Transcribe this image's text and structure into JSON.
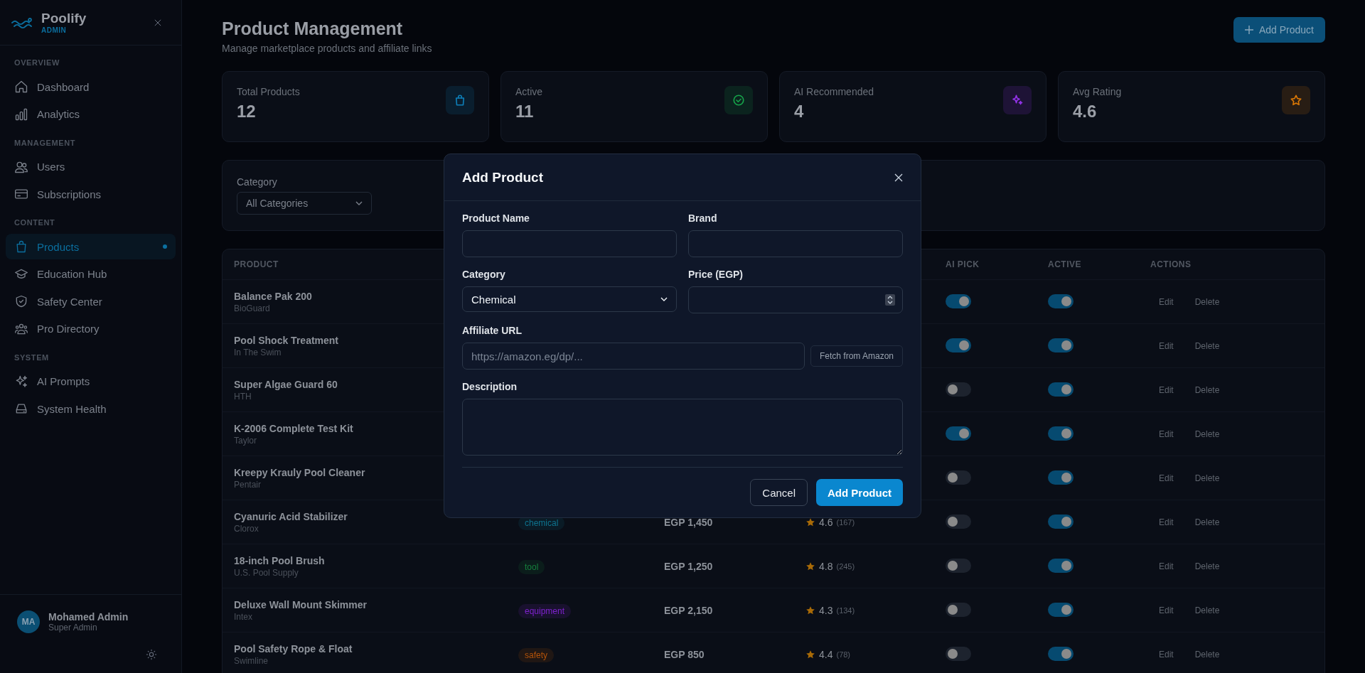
{
  "sidebar": {
    "brand": "Poolify",
    "badge": "ADMIN",
    "sections": [
      {
        "title": "OVERVIEW",
        "items": [
          {
            "label": "Dashboard",
            "selected": false
          },
          {
            "label": "Analytics",
            "selected": false
          }
        ]
      },
      {
        "title": "MANAGEMENT",
        "items": [
          {
            "label": "Users",
            "selected": false
          },
          {
            "label": "Subscriptions",
            "selected": false
          }
        ]
      },
      {
        "title": "CONTENT",
        "items": [
          {
            "label": "Products",
            "selected": true
          },
          {
            "label": "Education Hub",
            "selected": false
          },
          {
            "label": "Safety Center",
            "selected": false
          },
          {
            "label": "Pro Directory",
            "selected": false
          }
        ]
      },
      {
        "title": "SYSTEM",
        "items": [
          {
            "label": "AI Prompts",
            "selected": false
          },
          {
            "label": "System Health",
            "selected": false
          }
        ]
      }
    ],
    "user": {
      "initials": "MA",
      "name": "Mohamed Admin",
      "role": "Super Admin"
    }
  },
  "header": {
    "title": "Product Management",
    "subtitle": "Manage marketplace products and affiliate links",
    "action": "Add Product"
  },
  "stats": [
    {
      "label": "Total Products",
      "value": "12",
      "color": "#0e7fb8"
    },
    {
      "label": "Active",
      "value": "11",
      "color": "#16a34a"
    },
    {
      "label": "AI Recommended",
      "value": "4",
      "color": "#9333ea"
    },
    {
      "label": "Avg Rating",
      "value": "4.6",
      "color": "#d97706"
    }
  ],
  "filter": {
    "label": "Category",
    "value": "All Categories"
  },
  "table": {
    "columns": {
      "product": "PRODUCT",
      "ai_pick": "AI PICK",
      "active": "ACTIVE",
      "actions": "ACTIONS"
    },
    "rows": [
      {
        "name": "Balance Pak 200",
        "brand": "BioGuard",
        "ai_pick": true,
        "active": true,
        "actions": [
          "Edit",
          "Delete"
        ]
      },
      {
        "name": "Pool Shock Treatment",
        "brand": "In The Swim",
        "ai_pick": true,
        "active": true,
        "actions": [
          "Edit",
          "Delete"
        ]
      },
      {
        "name": "Super Algae Guard 60",
        "brand": "HTH",
        "ai_pick": false,
        "active": true,
        "actions": [
          "Edit",
          "Delete"
        ]
      },
      {
        "name": "K-2006 Complete Test Kit",
        "brand": "Taylor",
        "ai_pick": true,
        "active": true,
        "actions": [
          "Edit",
          "Delete"
        ]
      },
      {
        "name": "Kreepy Krauly Pool Cleaner",
        "brand": "Pentair",
        "ai_pick": false,
        "active": true,
        "actions": [
          "Edit",
          "Delete"
        ]
      },
      {
        "name": "Cyanuric Acid Stabilizer",
        "brand": "Clorox",
        "tag": {
          "label": "chemical",
          "color": "#0e7490"
        },
        "price": "EGP 1,450",
        "rating": "4.6",
        "reviews": "(167)",
        "ai_pick": false,
        "active": true,
        "actions": [
          "Edit",
          "Delete"
        ]
      },
      {
        "name": "18-inch Pool Brush",
        "brand": "U.S. Pool Supply",
        "tag": {
          "label": "tool",
          "color": "#15803d"
        },
        "price": "EGP 1,250",
        "rating": "4.8",
        "reviews": "(245)",
        "ai_pick": false,
        "active": true,
        "actions": [
          "Edit",
          "Delete"
        ]
      },
      {
        "name": "Deluxe Wall Mount Skimmer",
        "brand": "Intex",
        "tag": {
          "label": "equipment",
          "color": "#7e22ce"
        },
        "price": "EGP 2,150",
        "rating": "4.3",
        "reviews": "(134)",
        "ai_pick": false,
        "active": true,
        "actions": [
          "Edit",
          "Delete"
        ]
      },
      {
        "name": "Pool Safety Rope & Float",
        "brand": "Swimline",
        "tag": {
          "label": "safety",
          "color": "#b45309"
        },
        "price": "EGP 850",
        "rating": "4.4",
        "reviews": "(78)",
        "ai_pick": false,
        "active": true,
        "actions": [
          "Edit",
          "Delete"
        ]
      }
    ]
  },
  "modal": {
    "title": "Add Product",
    "fields": [
      {
        "label": "Product Name",
        "kind": "text"
      },
      {
        "label": "Brand",
        "kind": "text"
      },
      {
        "label": "Category",
        "kind": "select",
        "value": "Chemical"
      },
      {
        "label": "Price (EGP)",
        "kind": "number"
      },
      {
        "label": "Affiliate URL",
        "kind": "url",
        "placeholder": "https://amazon.eg/dp/...",
        "button": "Fetch from Amazon"
      },
      {
        "label": "Description",
        "kind": "textarea"
      }
    ],
    "cancel": "Cancel",
    "submit": "Add Product"
  }
}
